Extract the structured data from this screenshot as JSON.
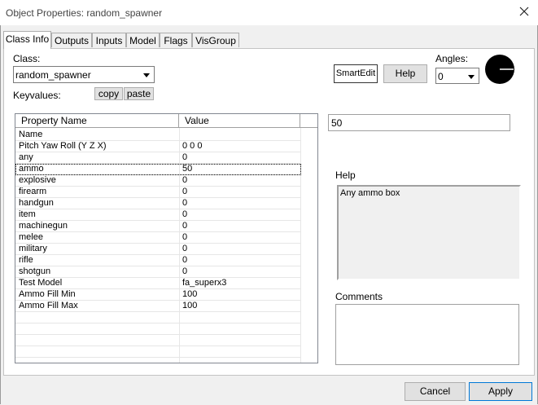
{
  "window": {
    "title": "Object Properties: random_spawner"
  },
  "tabs": [
    "Class Info",
    "Outputs",
    "Inputs",
    "Model",
    "Flags",
    "VisGroup"
  ],
  "class_info": {
    "class_label": "Class:",
    "class_value": "random_spawner",
    "keyvalues_label": "Keyvalues:",
    "copy_label": "copy",
    "paste_label": "paste",
    "smartedit_label": "SmartEdit",
    "help_button_label": "Help",
    "angles_label": "Angles:",
    "angles_value": "0",
    "value_field": "50",
    "help_label": "Help",
    "help_text": "Any ammo box",
    "comments_label": "Comments"
  },
  "grid": {
    "columns": [
      "Property Name",
      "Value"
    ],
    "rows": [
      {
        "name": "Name",
        "value": ""
      },
      {
        "name": "Pitch Yaw Roll (Y Z X)",
        "value": "0 0 0"
      },
      {
        "name": "any",
        "value": "0"
      },
      {
        "name": "ammo",
        "value": "50"
      },
      {
        "name": "explosive",
        "value": "0"
      },
      {
        "name": "firearm",
        "value": "0"
      },
      {
        "name": "handgun",
        "value": "0"
      },
      {
        "name": "item",
        "value": "0"
      },
      {
        "name": "machinegun",
        "value": "0"
      },
      {
        "name": "melee",
        "value": "0"
      },
      {
        "name": "military",
        "value": "0"
      },
      {
        "name": "rifle",
        "value": "0"
      },
      {
        "name": "shotgun",
        "value": "0"
      },
      {
        "name": "Test Model",
        "value": "fa_superx3"
      },
      {
        "name": "Ammo Fill Min",
        "value": "100"
      },
      {
        "name": "Ammo Fill Max",
        "value": "100"
      }
    ]
  },
  "footer": {
    "cancel_label": "Cancel",
    "apply_label": "Apply"
  }
}
